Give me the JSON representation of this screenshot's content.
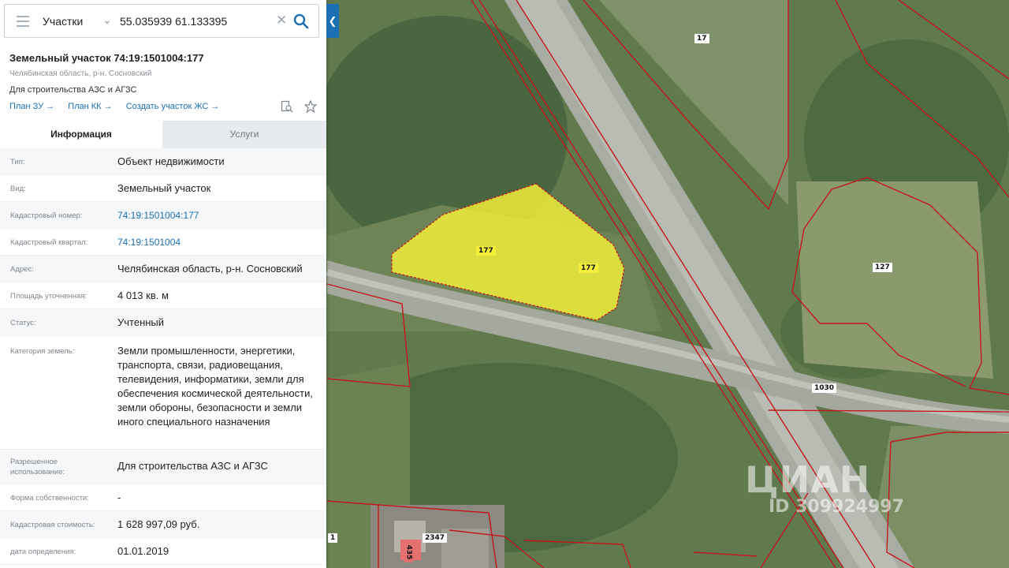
{
  "search": {
    "layer": "Участки",
    "query": "55.035939 61.133395"
  },
  "parcel": {
    "title": "Земельный участок 74:19:1501004:177",
    "region": "Челябинская область, р-н. Сосновский",
    "usage": "Для строительства АЗС и АГЗС"
  },
  "links": [
    "План ЗУ →",
    "План КК →",
    "Создать участок ЖС →"
  ],
  "tabs": [
    "Информация",
    "Услуги"
  ],
  "rows": [
    {
      "k": "Тип:",
      "v": "Объект недвижимости"
    },
    {
      "k": "Вид:",
      "v": "Земельный участок"
    },
    {
      "k": "Кадастровый номер:",
      "v": "74:19:1501004:177",
      "link": true
    },
    {
      "k": "Кадастровый квартал:",
      "v": "74:19:1501004",
      "link": true
    },
    {
      "k": "Адрес:",
      "v": "Челябинская область, р-н. Сосновский"
    },
    {
      "k": "Площадь уточненная:",
      "v": "4 013 кв. м"
    },
    {
      "k": "Статус:",
      "v": "Учтенный"
    },
    {
      "k": "Категория земель:",
      "v": "Земли промышленности, энергетики, транспорта, связи, радиовещания, телевидения, информатики, земли для обеспечения космической деятельности, земли обороны, безопасности и земли иного специального назначения"
    },
    {
      "k": "Разрешенное использование:",
      "v": "Для строительства АЗС и АГЗС"
    },
    {
      "k": "Форма собственности:",
      "v": "-"
    },
    {
      "k": "Кадастровая стоимость:",
      "v": "1 628 997,09 руб."
    },
    {
      "k": "дата определения:",
      "v": "01.01.2019"
    }
  ],
  "map": {
    "labels": [
      "177",
      "177",
      "17",
      "127",
      "1030",
      "2347",
      "435",
      "1"
    ],
    "watermark_brand": "ЦИАН",
    "watermark_id": "ID 309924997"
  },
  "colors": {
    "accent": "#1b6fb5",
    "parcel_fill": "#f4f03a",
    "boundary": "#c4161c"
  },
  "icons": [
    "menu-icon",
    "chevron-down-icon",
    "close-icon",
    "search-icon",
    "chevron-left-icon",
    "document-search-icon",
    "star-icon"
  ]
}
